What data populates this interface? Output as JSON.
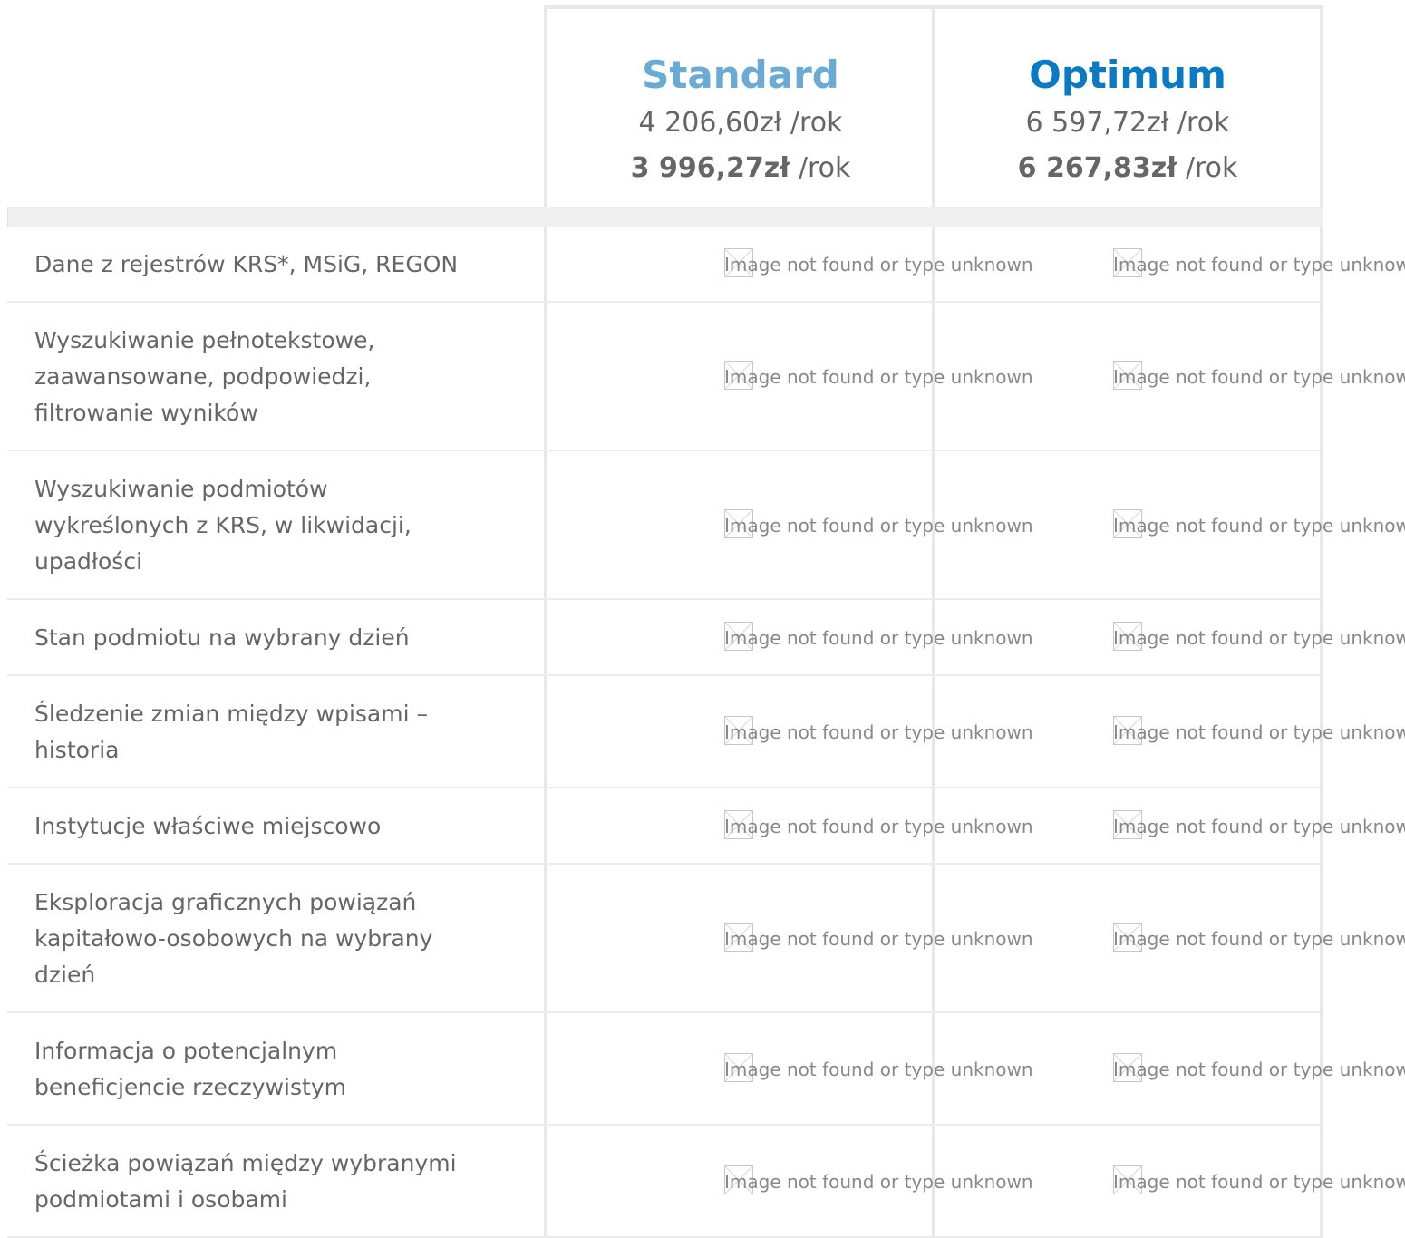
{
  "plans": [
    {
      "name": "Standard",
      "price_regular": "4 206,60zł /rok",
      "price_discount_value": "3 996,27zł",
      "price_discount_suffix": " /rok",
      "color": "#6aabd6"
    },
    {
      "name": "Optimum",
      "price_regular": "6 597,72zł /rok",
      "price_discount_value": "6 267,83zł",
      "price_discount_suffix": " /rok",
      "color": "#0a7ac4"
    }
  ],
  "image_placeholder": "Image not found or type unknown",
  "features": [
    "Dane z rejestrów KRS*, MSiG, REGON",
    "Wyszukiwanie pełnotekstowe, zaawansowane, podpowiedzi, filtrowanie wyników",
    "Wyszukiwanie podmiotów wykreślonych z KRS, w likwidacji, upadłości",
    "Stan podmiotu na wybrany dzień",
    "Śledzenie zmian między wpisami – historia",
    "Instytucje właściwe miejscowo",
    "Eksploracja graficznych powiązań kapitałowo-osobowych na wybrany dzień",
    "Informacja o potencjalnym beneficjencie rzeczywistym",
    "Ścieżka powiązań między wybranymi podmiotami i osobami"
  ]
}
